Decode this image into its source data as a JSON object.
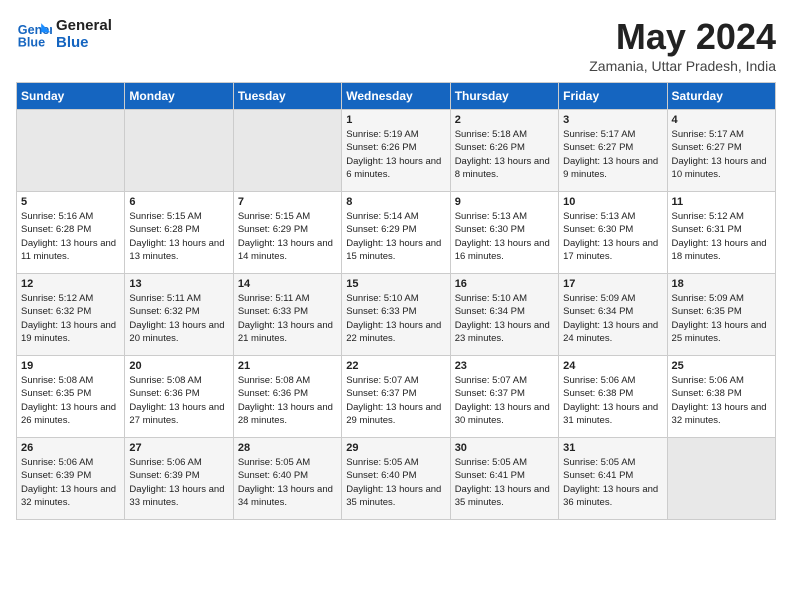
{
  "logo": {
    "line1": "General",
    "line2": "Blue"
  },
  "title": "May 2024",
  "subtitle": "Zamania, Uttar Pradesh, India",
  "days_header": [
    "Sunday",
    "Monday",
    "Tuesday",
    "Wednesday",
    "Thursday",
    "Friday",
    "Saturday"
  ],
  "weeks": [
    [
      {
        "num": "",
        "info": ""
      },
      {
        "num": "",
        "info": ""
      },
      {
        "num": "",
        "info": ""
      },
      {
        "num": "1",
        "info": "Sunrise: 5:19 AM\nSunset: 6:26 PM\nDaylight: 13 hours and 6 minutes."
      },
      {
        "num": "2",
        "info": "Sunrise: 5:18 AM\nSunset: 6:26 PM\nDaylight: 13 hours and 8 minutes."
      },
      {
        "num": "3",
        "info": "Sunrise: 5:17 AM\nSunset: 6:27 PM\nDaylight: 13 hours and 9 minutes."
      },
      {
        "num": "4",
        "info": "Sunrise: 5:17 AM\nSunset: 6:27 PM\nDaylight: 13 hours and 10 minutes."
      }
    ],
    [
      {
        "num": "5",
        "info": "Sunrise: 5:16 AM\nSunset: 6:28 PM\nDaylight: 13 hours and 11 minutes."
      },
      {
        "num": "6",
        "info": "Sunrise: 5:15 AM\nSunset: 6:28 PM\nDaylight: 13 hours and 13 minutes."
      },
      {
        "num": "7",
        "info": "Sunrise: 5:15 AM\nSunset: 6:29 PM\nDaylight: 13 hours and 14 minutes."
      },
      {
        "num": "8",
        "info": "Sunrise: 5:14 AM\nSunset: 6:29 PM\nDaylight: 13 hours and 15 minutes."
      },
      {
        "num": "9",
        "info": "Sunrise: 5:13 AM\nSunset: 6:30 PM\nDaylight: 13 hours and 16 minutes."
      },
      {
        "num": "10",
        "info": "Sunrise: 5:13 AM\nSunset: 6:30 PM\nDaylight: 13 hours and 17 minutes."
      },
      {
        "num": "11",
        "info": "Sunrise: 5:12 AM\nSunset: 6:31 PM\nDaylight: 13 hours and 18 minutes."
      }
    ],
    [
      {
        "num": "12",
        "info": "Sunrise: 5:12 AM\nSunset: 6:32 PM\nDaylight: 13 hours and 19 minutes."
      },
      {
        "num": "13",
        "info": "Sunrise: 5:11 AM\nSunset: 6:32 PM\nDaylight: 13 hours and 20 minutes."
      },
      {
        "num": "14",
        "info": "Sunrise: 5:11 AM\nSunset: 6:33 PM\nDaylight: 13 hours and 21 minutes."
      },
      {
        "num": "15",
        "info": "Sunrise: 5:10 AM\nSunset: 6:33 PM\nDaylight: 13 hours and 22 minutes."
      },
      {
        "num": "16",
        "info": "Sunrise: 5:10 AM\nSunset: 6:34 PM\nDaylight: 13 hours and 23 minutes."
      },
      {
        "num": "17",
        "info": "Sunrise: 5:09 AM\nSunset: 6:34 PM\nDaylight: 13 hours and 24 minutes."
      },
      {
        "num": "18",
        "info": "Sunrise: 5:09 AM\nSunset: 6:35 PM\nDaylight: 13 hours and 25 minutes."
      }
    ],
    [
      {
        "num": "19",
        "info": "Sunrise: 5:08 AM\nSunset: 6:35 PM\nDaylight: 13 hours and 26 minutes."
      },
      {
        "num": "20",
        "info": "Sunrise: 5:08 AM\nSunset: 6:36 PM\nDaylight: 13 hours and 27 minutes."
      },
      {
        "num": "21",
        "info": "Sunrise: 5:08 AM\nSunset: 6:36 PM\nDaylight: 13 hours and 28 minutes."
      },
      {
        "num": "22",
        "info": "Sunrise: 5:07 AM\nSunset: 6:37 PM\nDaylight: 13 hours and 29 minutes."
      },
      {
        "num": "23",
        "info": "Sunrise: 5:07 AM\nSunset: 6:37 PM\nDaylight: 13 hours and 30 minutes."
      },
      {
        "num": "24",
        "info": "Sunrise: 5:06 AM\nSunset: 6:38 PM\nDaylight: 13 hours and 31 minutes."
      },
      {
        "num": "25",
        "info": "Sunrise: 5:06 AM\nSunset: 6:38 PM\nDaylight: 13 hours and 32 minutes."
      }
    ],
    [
      {
        "num": "26",
        "info": "Sunrise: 5:06 AM\nSunset: 6:39 PM\nDaylight: 13 hours and 32 minutes."
      },
      {
        "num": "27",
        "info": "Sunrise: 5:06 AM\nSunset: 6:39 PM\nDaylight: 13 hours and 33 minutes."
      },
      {
        "num": "28",
        "info": "Sunrise: 5:05 AM\nSunset: 6:40 PM\nDaylight: 13 hours and 34 minutes."
      },
      {
        "num": "29",
        "info": "Sunrise: 5:05 AM\nSunset: 6:40 PM\nDaylight: 13 hours and 35 minutes."
      },
      {
        "num": "30",
        "info": "Sunrise: 5:05 AM\nSunset: 6:41 PM\nDaylight: 13 hours and 35 minutes."
      },
      {
        "num": "31",
        "info": "Sunrise: 5:05 AM\nSunset: 6:41 PM\nDaylight: 13 hours and 36 minutes."
      },
      {
        "num": "",
        "info": ""
      }
    ]
  ]
}
